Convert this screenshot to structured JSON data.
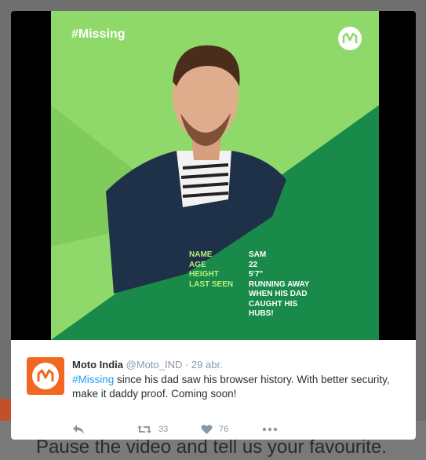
{
  "background": {
    "caption": "Pause the video and tell us your favourite."
  },
  "media": {
    "hashtag_label": "#Missing",
    "colors": {
      "light_green": "#8fd96a",
      "dark_green": "#1a8a4a",
      "accent": "#b6f07a"
    },
    "fields": [
      {
        "label": "NAME",
        "value": "SAM"
      },
      {
        "label": "AGE",
        "value": "22"
      },
      {
        "label": "HEIGHT",
        "value": "5'7\""
      },
      {
        "label": "LAST SEEN",
        "value": "RUNNING AWAY WHEN HIS DAD CAUGHT HIS HUBS!"
      }
    ]
  },
  "tweet": {
    "author_name": "Moto India",
    "handle": "@Moto_IND",
    "separator": " · ",
    "date": "29 abr.",
    "text_hashtag": "#Missing",
    "text_body": " since his dad saw his browser history. With better security, make it daddy proof. Coming soon!",
    "actions": {
      "reply_icon": "reply-icon",
      "retweet_count": "33",
      "like_count": "76",
      "more_icon": "more-icon"
    }
  }
}
